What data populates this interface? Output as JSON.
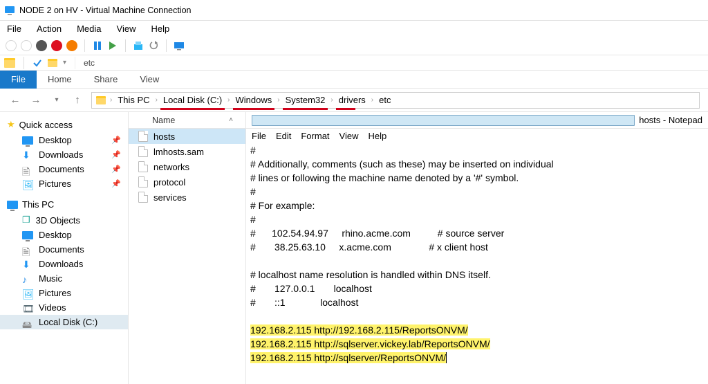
{
  "window": {
    "title": "NODE 2 on HV - Virtual Machine Connection"
  },
  "vm_menu": {
    "file": "File",
    "action": "Action",
    "media": "Media",
    "view": "View",
    "help": "Help"
  },
  "explorer_tabs": {
    "current": "etc"
  },
  "ribbon": {
    "file": "File",
    "home": "Home",
    "share": "Share",
    "view": "View"
  },
  "nav": {
    "back": "←",
    "fwd": "→",
    "up": "↑"
  },
  "breadcrumb": {
    "items": [
      {
        "label": "This PC"
      },
      {
        "label": "Local Disk (C:)"
      },
      {
        "label": "Windows"
      },
      {
        "label": "System32"
      },
      {
        "label": "drivers"
      },
      {
        "label": "etc"
      }
    ]
  },
  "sidepane": {
    "quick": "Quick access",
    "desktop": "Desktop",
    "downloads": "Downloads",
    "documents": "Documents",
    "pictures": "Pictures",
    "thispc": "This PC",
    "objects3d": "3D Objects",
    "desktop2": "Desktop",
    "documents2": "Documents",
    "downloads2": "Downloads",
    "music": "Music",
    "pictures2": "Pictures",
    "videos": "Videos",
    "localdisk": "Local Disk (C:)"
  },
  "filelist": {
    "header": "Name",
    "rows": [
      "hosts",
      "lmhosts.sam",
      "networks",
      "protocol",
      "services"
    ]
  },
  "notepad": {
    "title": "hosts - Notepad",
    "menu": {
      "file": "File",
      "edit": "Edit",
      "format": "Format",
      "view": "View",
      "help": "Help"
    },
    "lines": [
      "#",
      "# Additionally, comments (such as these) may be inserted on individual",
      "# lines or following the machine name denoted by a '#' symbol.",
      "#",
      "# For example:",
      "#",
      "#      102.54.94.97     rhino.acme.com          # source server",
      "#       38.25.63.10     x.acme.com              # x client host",
      "",
      "# localhost name resolution is handled within DNS itself.",
      "#       127.0.0.1       localhost",
      "#       ::1             localhost",
      ""
    ],
    "hl_lines": [
      "192.168.2.115 http://192.168.2.115/ReportsONVM/",
      "192.168.2.115 http://sqlserver.vickey.lab/ReportsONVM/",
      "192.168.2.115 http://sqlserver/ReportsONVM/"
    ]
  }
}
